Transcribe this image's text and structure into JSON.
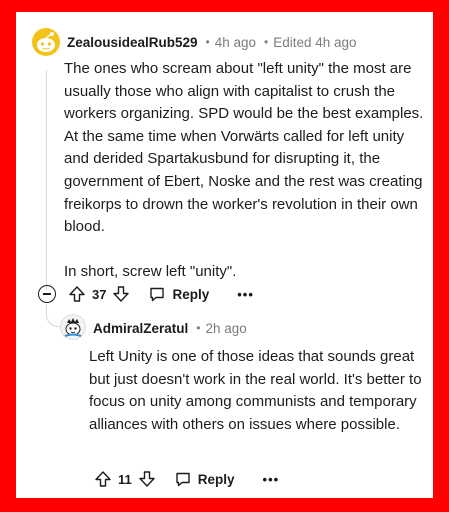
{
  "comment": {
    "author": "ZealousidealRub529",
    "separator": "•",
    "time": "4h ago",
    "edited": "Edited 4h ago",
    "paragraphs": [
      "The ones who scream about \"left unity\" the most are usually those who align with capitalist to crush the workers organizing. SPD would be the best examples. At the same time when Vorwärts called for left unity and derided Spartakusbund for disrupting it, the government of Ebert, Noske and the rest was creating freikorps to drown the worker's revolution in their own blood.",
      "In short, screw left \"unity\"."
    ],
    "score": "37",
    "reply_label": "Reply",
    "more_label": "•••"
  },
  "reply": {
    "author": "AdmiralZeratul",
    "separator": "•",
    "time": "2h ago",
    "paragraphs": [
      "Left Unity is one of those ideas that sounds great but just doesn't work in the real world. It's better to focus on unity among communists and temporary alliances with others on issues where possible."
    ],
    "score": "11",
    "reply_label": "Reply",
    "more_label": "•••"
  },
  "colors": {
    "frame": "#ff0000",
    "text": "#1c1c1c",
    "muted": "#7c7c7c",
    "thread": "#d7dadc",
    "avatar_bg": "#f2c21a"
  },
  "icons": [
    "snoo-avatar",
    "upvote-icon",
    "downvote-icon",
    "reply-bubble-icon",
    "collapse-icon",
    "more-icon"
  ]
}
